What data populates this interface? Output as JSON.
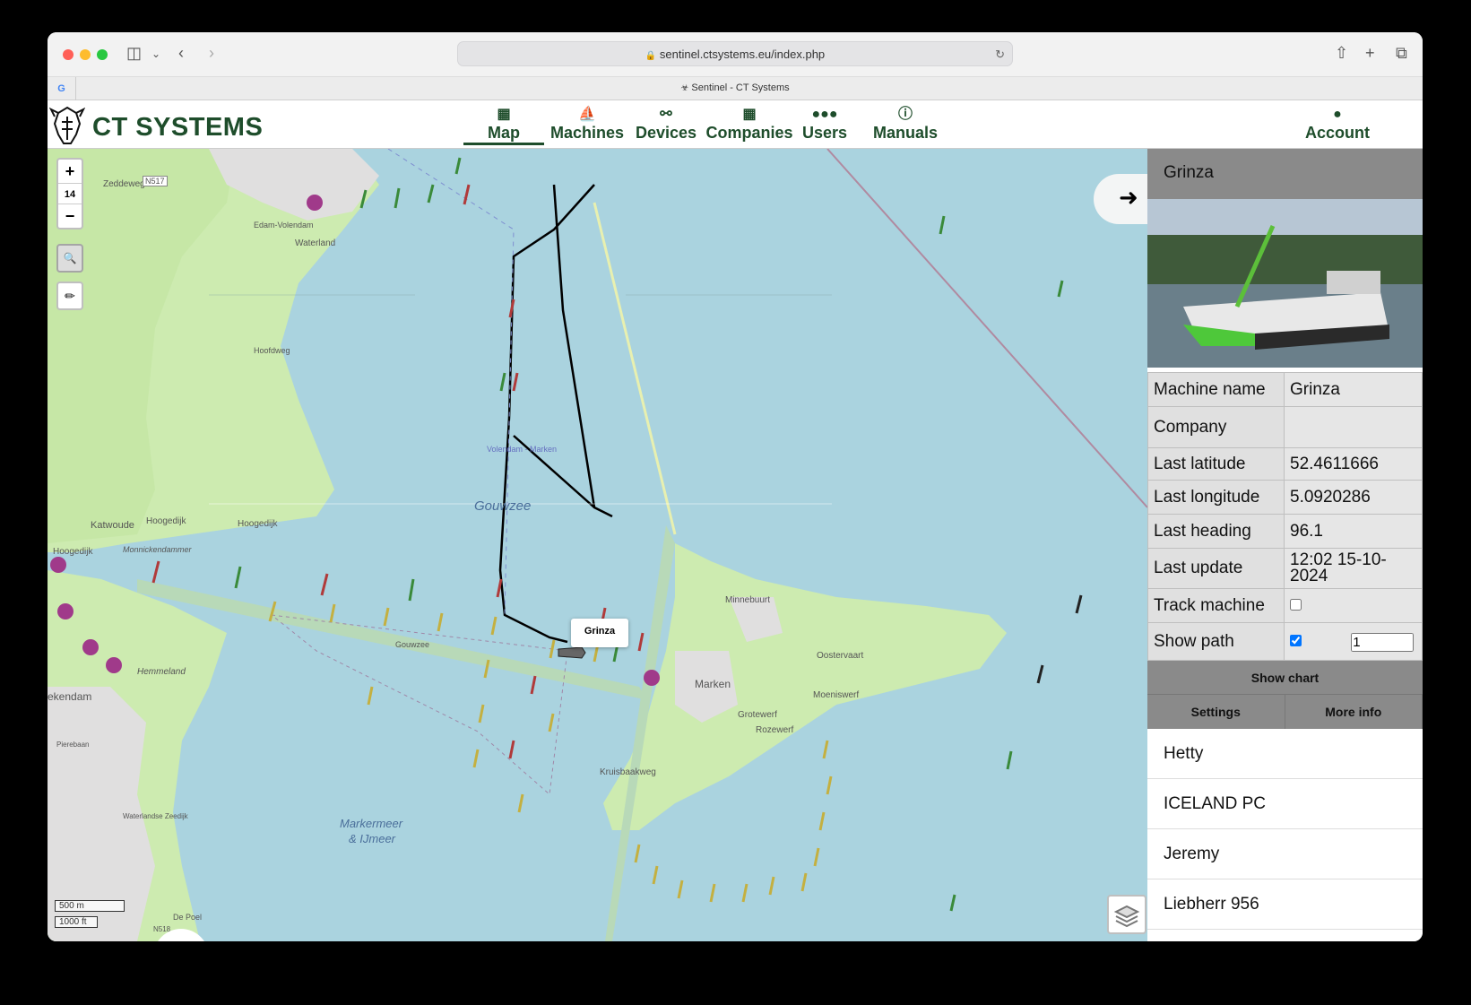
{
  "browser": {
    "url": "sentinel.ctsystems.eu/index.php",
    "tab_title": "Sentinel - CT Systems"
  },
  "nav": {
    "brand": "CT SYSTEMS",
    "items": [
      {
        "label": "Map",
        "icon": "map-icon"
      },
      {
        "label": "Machines",
        "icon": "ship-icon"
      },
      {
        "label": "Devices",
        "icon": "usb-icon"
      },
      {
        "label": "Companies",
        "icon": "building-icon"
      },
      {
        "label": "Users",
        "icon": "users-icon"
      },
      {
        "label": "Manuals",
        "icon": "info-icon"
      }
    ],
    "account": "Account"
  },
  "map": {
    "zoom_level": "14",
    "zoom_in": "+",
    "zoom_out": "−",
    "scale_m": "500 m",
    "scale_ft": "1000 ft",
    "popup_label": "Grinza",
    "labels": {
      "gouwzee": "Gouwzee",
      "markermeer_1": "Markermeer",
      "markermeer_2": "& IJmeer",
      "marken": "Marken",
      "minnebuurt": "Minnebuurt",
      "moeniswerf": "Moeniswerf",
      "grotewerf": "Grotewerf",
      "rozewerf": "Rozewerf",
      "katwoude": "Katwoude",
      "hemmeland": "Hemmeland",
      "edam": "ekendam",
      "zeddeweg": "Zeddeweg",
      "waterland": "Waterland",
      "n517": "N517",
      "hoogedijk": "Hoogedijk",
      "hoogedijk_2": "Hoogedijk",
      "hoogedijk_3": "Hoogedijk",
      "gouwzee_small": "Gouwzee",
      "oostervaart": "Oostervaart",
      "kruisbaakweg": "Kruisbaakweg",
      "volendam_marken": "Volendam - Marken",
      "edam_volendam": "Edam-Volendam",
      "purmerdijk": "Hoofdweg",
      "monnickendammer": "Monnickendammer",
      "de_poel": "De Poel",
      "n518": "N518",
      "pierebaan": "Pierebaan",
      "waterlandse": "Waterlandse Zeedijk"
    }
  },
  "panel": {
    "title": "Grinza",
    "rows": [
      {
        "key": "Machine name",
        "value": "Grinza"
      },
      {
        "key": "Company",
        "value": ""
      },
      {
        "key": "Last latitude",
        "value": "52.4611666"
      },
      {
        "key": "Last longitude",
        "value": "5.0920286"
      },
      {
        "key": "Last heading",
        "value": "96.1"
      },
      {
        "key": "Last update",
        "value": "12:02 15-10-2024"
      }
    ],
    "track_machine_label": "Track machine",
    "track_machine_checked": false,
    "show_path_label": "Show path",
    "show_path_checked": true,
    "show_path_value": "1",
    "show_chart": "Show chart",
    "settings": "Settings",
    "more_info": "More info",
    "machines": [
      "Hetty",
      "ICELAND PC",
      "Jeremy",
      "Liebherr 956"
    ]
  }
}
